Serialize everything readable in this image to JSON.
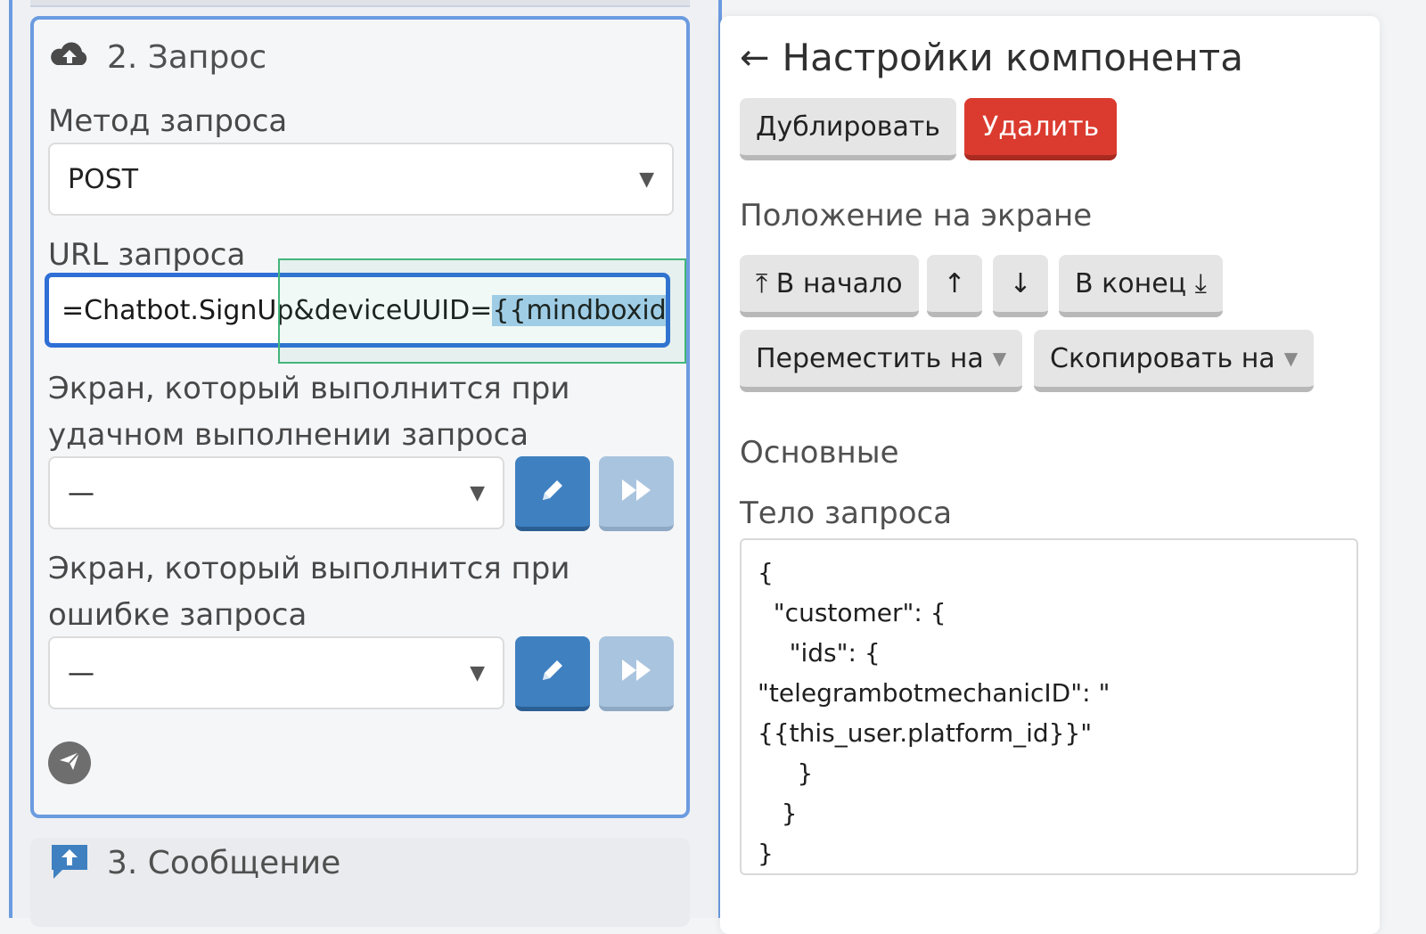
{
  "left": {
    "request_section": {
      "title": "2. Запрос",
      "method_label": "Метод запроса",
      "method_value": "POST",
      "url_label": "URL запроса",
      "url_value_plain": "=Chatbot.SignUp&deviceUUID=",
      "url_value_selected": "{{mindboxid}}",
      "success_label_line1": "Экран, который выполнится при",
      "success_label_line2": "удачном выполнении запроса",
      "success_value": "—",
      "error_label_line1": "Экран, который выполнится при",
      "error_label_line2": "ошибке запроса",
      "error_value": "—"
    },
    "message_section": {
      "title": "3. Сообщение"
    }
  },
  "right": {
    "title": "Настройки компонента",
    "back_arrow": "←",
    "duplicate_label": "Дублировать",
    "delete_label": "Удалить",
    "position_label": "Положение на экране",
    "to_start_label": "⤒ В начало",
    "up_label": "↑",
    "down_label": "↓",
    "to_end_label": "В конец ⤓",
    "move_to_label": "Переместить на",
    "copy_to_label": "Скопировать на",
    "basic_label": "Основные",
    "body_label": "Тело запроса",
    "body_value": "{\n  \"customer\": {\n    \"ids\": {\n\"telegrambotmechanicID\": \"\n{{this_user.platform_id}}\"\n     }\n   }\n}"
  },
  "colors": {
    "accent_blue": "#2f6fd6",
    "card_border": "#6b9be0",
    "edit_button": "#3f80c0",
    "skip_button": "#a9c4de",
    "delete_red": "#db3b2f",
    "selection_highlight": "#a9d0ef",
    "focus_frame_green": "#43b57a"
  },
  "icons": {
    "request_section": "cloud-upload-icon",
    "message_section": "chat-upload-icon",
    "edit": "pencil-icon",
    "skip": "fast-forward-icon",
    "send": "paper-plane-icon",
    "dropdown": "triangle-down-icon"
  }
}
